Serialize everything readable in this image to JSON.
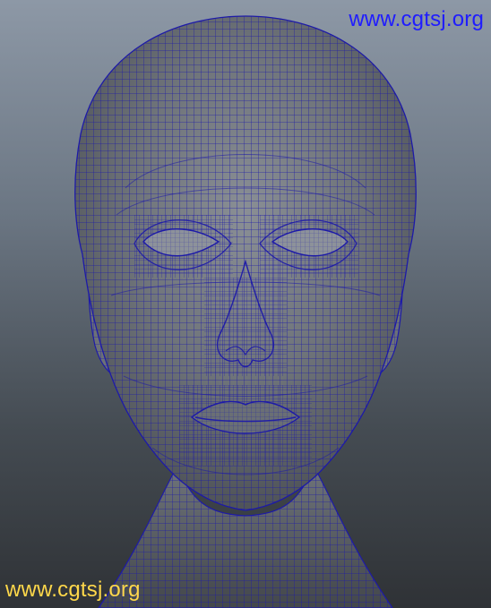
{
  "viewport": {
    "watermark_top": "www.cgtsj.org",
    "watermark_bottom": "www.cgtsj.org",
    "colors": {
      "background_top": "#8d98a6",
      "background_bottom": "#2f3236",
      "mesh_fill": "#6e7278",
      "wireframe": "#1d1aa8",
      "watermark_top": "#1f1cff",
      "watermark_bottom": "#ffd84a"
    }
  }
}
